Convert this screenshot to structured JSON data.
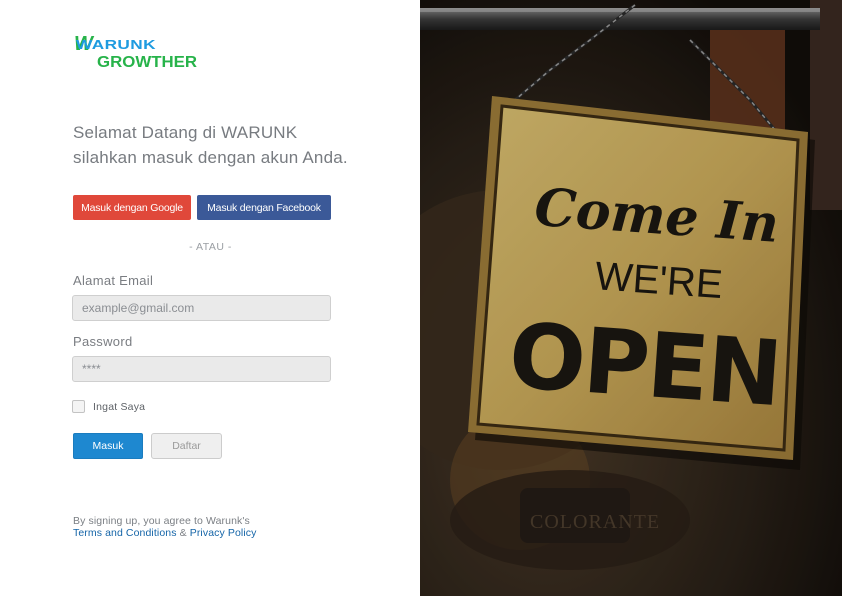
{
  "brand": {
    "logo_line1": "WARUNK",
    "logo_line2": "GROWTHER",
    "logo_color": "#27b34a",
    "logo_accent": "#1e9be0"
  },
  "welcome": {
    "line1": "Selamat Datang di WARUNK",
    "line2": "silahkan masuk dengan akun Anda."
  },
  "social": {
    "google_label": "Masuk dengan Google",
    "facebook_label": "Masuk dengan Facebook",
    "google_color": "#e0483a",
    "facebook_color": "#3b5998"
  },
  "divider_text": "- ATAU -",
  "form": {
    "email_label": "Alamat Email",
    "email_placeholder": "example@gmail.com",
    "email_value": "",
    "password_label": "Password",
    "password_placeholder": "****",
    "password_value": "",
    "remember_label": "Ingat Saya",
    "remember_checked": false
  },
  "actions": {
    "login_label": "Masuk",
    "register_label": "Daftar",
    "primary_color": "#1e88d0"
  },
  "terms": {
    "prefix": "By signing up, you agree to Warunk's",
    "terms_link": "Terms and Conditions",
    "ampersand": "&",
    "privacy_link": "Privacy Policy",
    "link_color": "#1565a8"
  },
  "hero_image": {
    "sign_line1": "Come In",
    "sign_line2": "WE'RE",
    "sign_line3": "OPEN",
    "background_sign": "COLORANTE"
  }
}
